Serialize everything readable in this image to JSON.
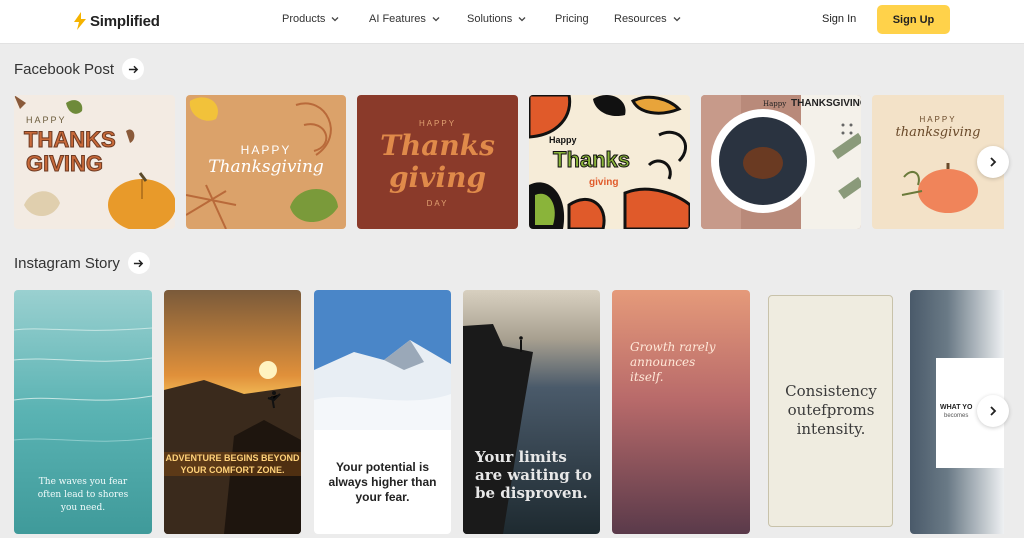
{
  "header": {
    "brand": "Simplified",
    "nav": [
      {
        "label": "Products",
        "has_dropdown": true
      },
      {
        "label": "AI Features",
        "has_dropdown": true
      },
      {
        "label": "Solutions",
        "has_dropdown": true
      },
      {
        "label": "Pricing",
        "has_dropdown": false
      },
      {
        "label": "Resources",
        "has_dropdown": true
      }
    ],
    "sign_in": "Sign In",
    "sign_up": "Sign Up"
  },
  "sections": {
    "facebook": {
      "title": "Facebook Post",
      "cards": [
        {
          "t1": "HAPPY",
          "t2": "THANKS",
          "t3": "GIVING"
        },
        {
          "t1": "HAPPY",
          "t2": "Thanksgiving"
        },
        {
          "t1": "HAPPY",
          "t2": "Thanks",
          "t3": "giving",
          "t4": "DAY"
        },
        {
          "t1": "Happy",
          "t2": "Thanks",
          "t3": "giving"
        },
        {
          "t1": "Happy",
          "t2": "THANKSGIVING"
        },
        {
          "t1": "HAPPY",
          "t2": "thanksgiving"
        }
      ]
    },
    "instagram": {
      "title": "Instagram Story",
      "cards": [
        {
          "text": "The waves you fear often lead to shores you need."
        },
        {
          "line1": "ADVENTURE BEGINS BEYOND",
          "line2": "YOUR COMFORT ZONE."
        },
        {
          "text": "Your potential is always higher than your fear."
        },
        {
          "text": "Your limits are waiting to be disproven."
        },
        {
          "text": "Growth rarely announces itself."
        },
        {
          "text": "Consistency outefproms intensity."
        },
        {
          "line1": "WHAT YO",
          "line2": "becomes"
        }
      ]
    }
  },
  "colors": {
    "accent": "#ffd24a",
    "background": "#ececec"
  }
}
